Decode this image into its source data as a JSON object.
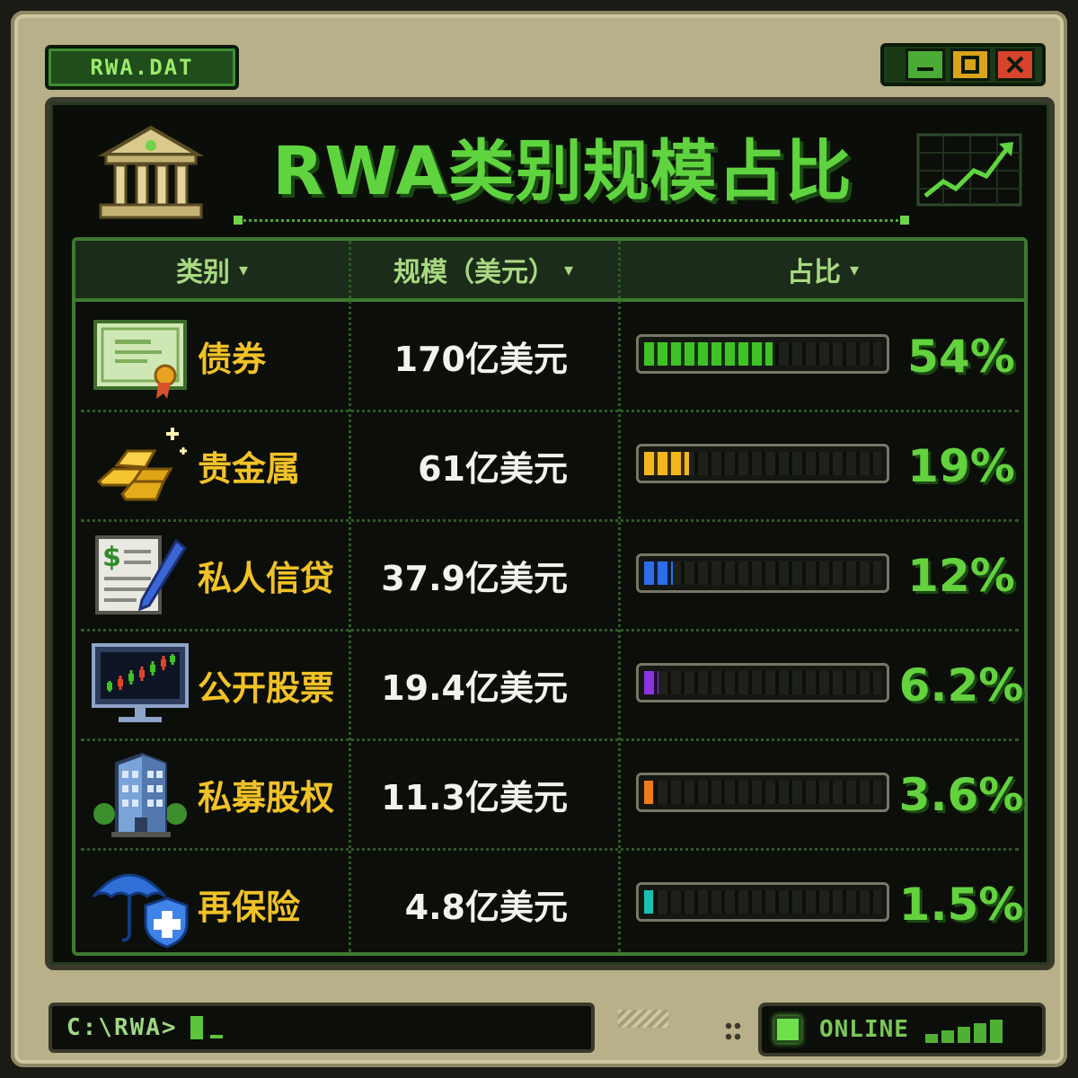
{
  "window": {
    "title": "RWA.DAT",
    "controls": {
      "minimize": "▁",
      "maximize": "□",
      "close": "✕"
    }
  },
  "header": {
    "title": "RWA类别规模占比",
    "icons": [
      "bank-icon",
      "trend-chart-icon"
    ]
  },
  "table": {
    "columns": [
      {
        "label": "类别",
        "sort_icon": "▾"
      },
      {
        "label": "规模（美元）",
        "sort_icon": "▾"
      },
      {
        "label": "占比",
        "sort_icon": "▾"
      }
    ],
    "rows": [
      {
        "icon": "bond-certificate-icon",
        "category": "债券",
        "size": "170亿美元",
        "share": "54%",
        "share_value": 54,
        "color": "#3fc226"
      },
      {
        "icon": "gold-bars-icon",
        "category": "贵金属",
        "size": "61亿美元",
        "share": "19%",
        "share_value": 19,
        "color": "#f2b71c"
      },
      {
        "icon": "loan-document-icon",
        "category": "私人信贷",
        "size": "37.9亿美元",
        "share": "12%",
        "share_value": 12,
        "color": "#2d6ee8"
      },
      {
        "icon": "stock-monitor-icon",
        "category": "公开股票",
        "size": "19.4亿美元",
        "share": "6.2%",
        "share_value": 6.2,
        "color": "#8a35e0"
      },
      {
        "icon": "office-building-icon",
        "category": "私募股权",
        "size": "11.3亿美元",
        "share": "3.6%",
        "share_value": 3.6,
        "color": "#ef7a1a"
      },
      {
        "icon": "umbrella-shield-icon",
        "category": "再保险",
        "size": "4.8亿美元",
        "share": "1.5%",
        "share_value": 1.5,
        "color": "#19c1b2"
      }
    ]
  },
  "statusbar": {
    "prompt": "C:\\RWA>",
    "status": "ONLINE"
  },
  "colors": {
    "accent": "#5fd43f",
    "category_text": "#f1c227",
    "frame": "#b8b088"
  }
}
